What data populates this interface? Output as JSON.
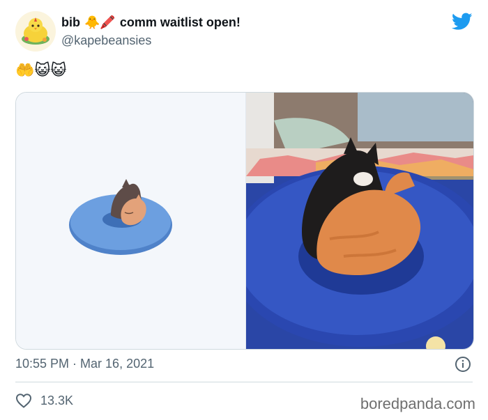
{
  "author": {
    "display_name": "bib",
    "name_emoji": "🐥🖍️",
    "name_suffix": "comm waitlist open!",
    "handle": "@kapebeansies"
  },
  "tweet": {
    "text": "🤲😺😺"
  },
  "meta": {
    "timestamp": "10:55 PM · Mar 16, 2021"
  },
  "engagement": {
    "likes": "13.3K"
  },
  "watermark": "boredpanda.com",
  "colors": {
    "twitter_blue": "#1d9bf0",
    "secondary_text": "#536471",
    "border": "#cfd9de"
  },
  "icons": {
    "brand": "twitter-bird-icon",
    "info": "info-icon",
    "like": "heart-icon"
  }
}
